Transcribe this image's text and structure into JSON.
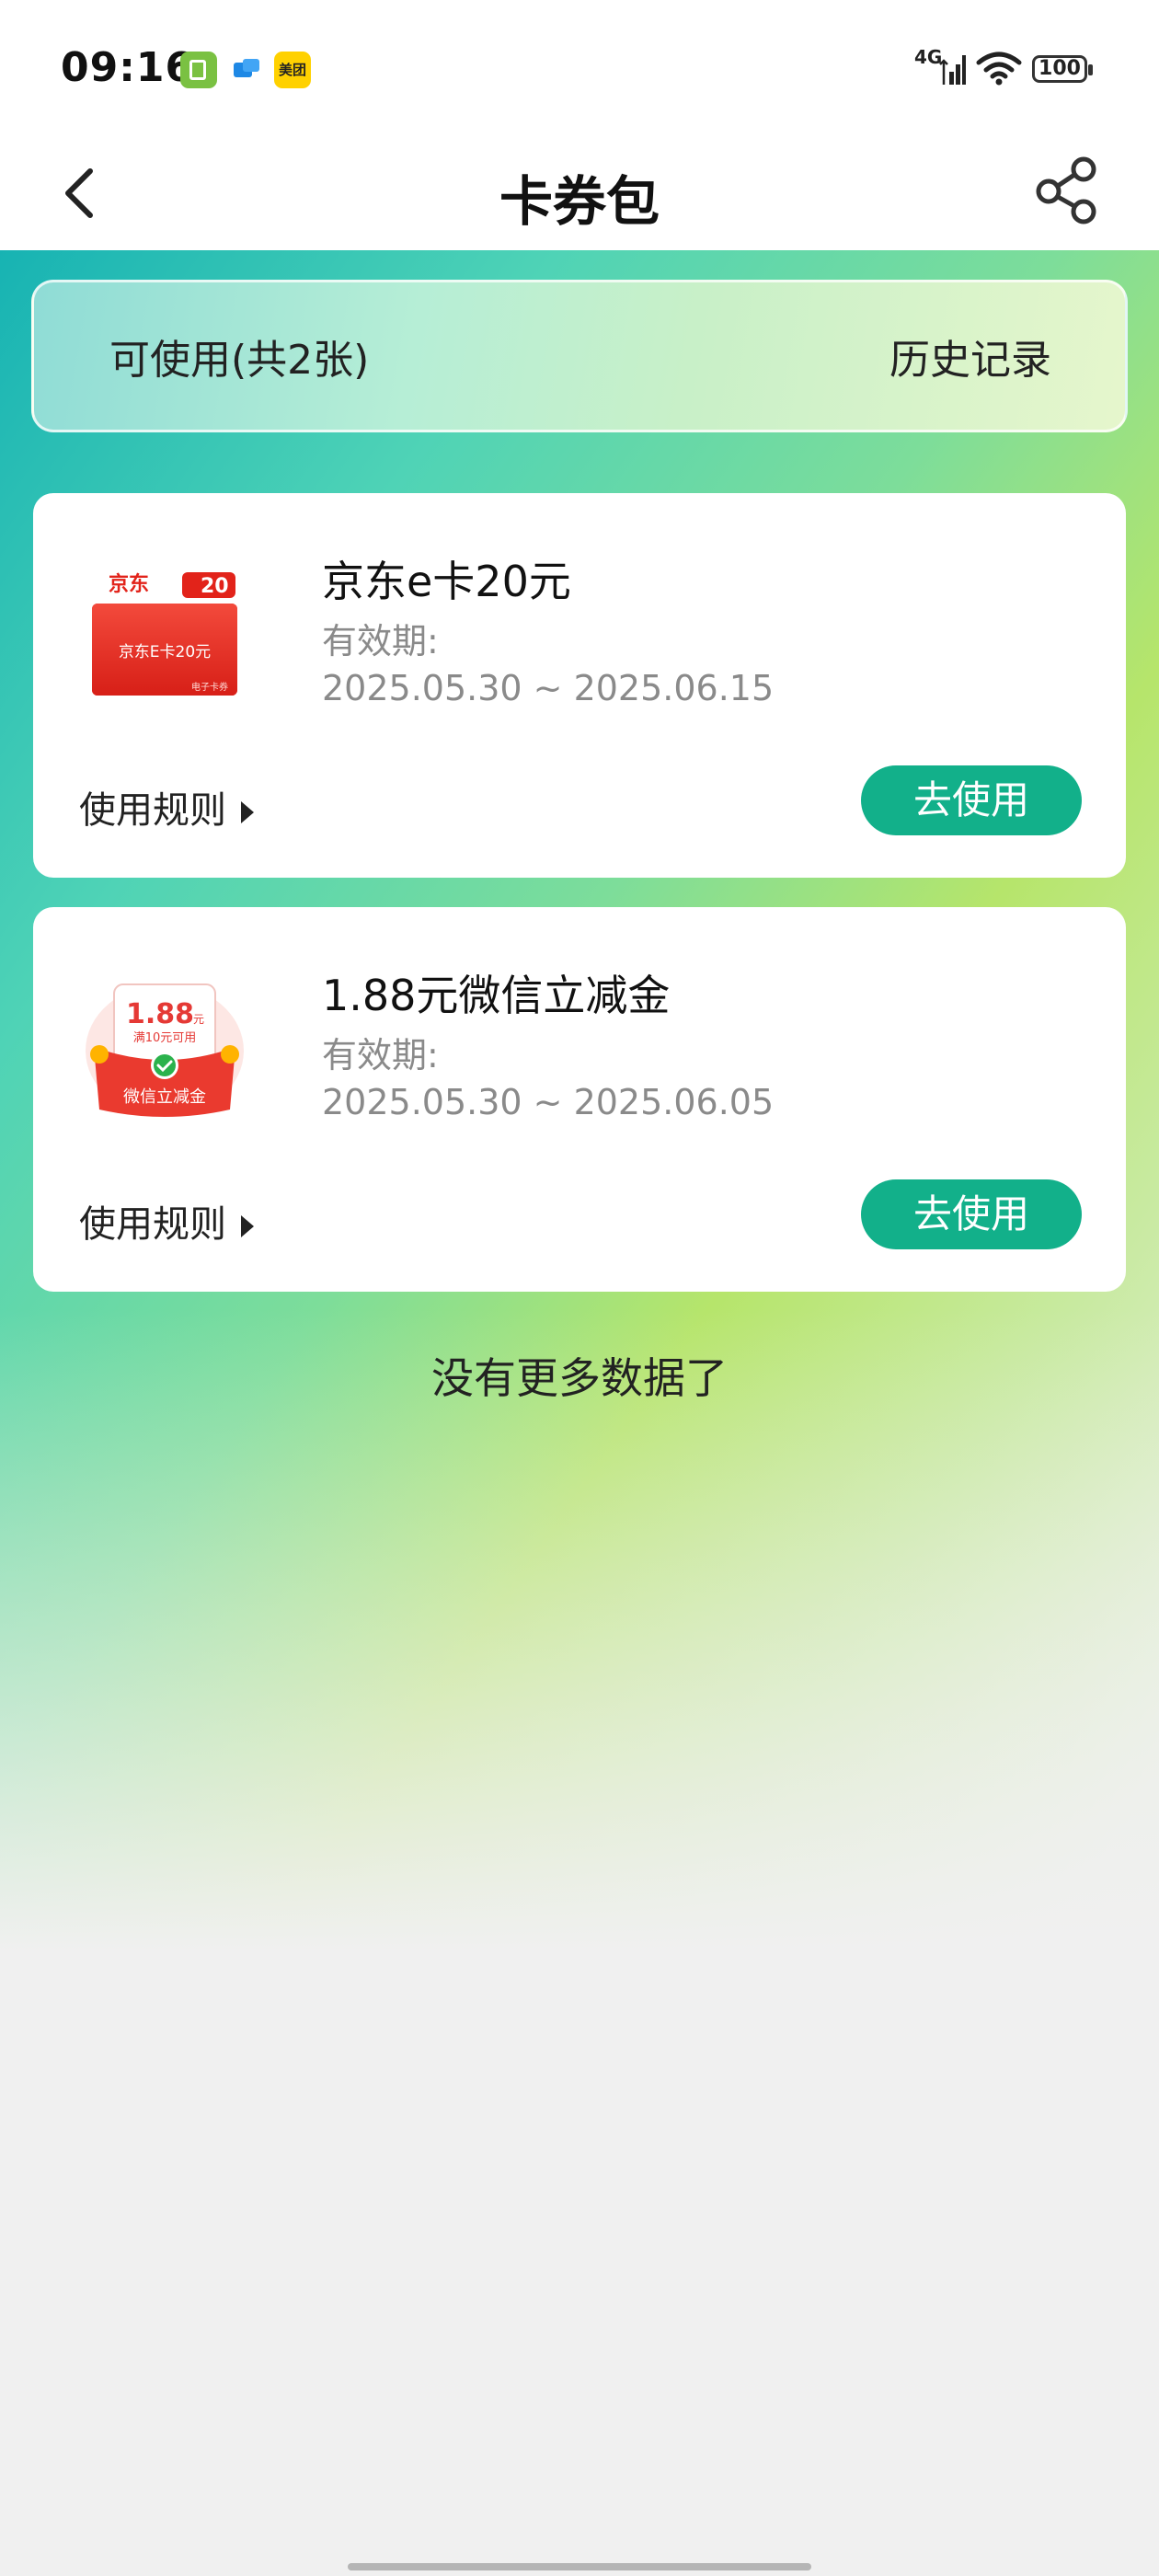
{
  "status_bar": {
    "time": "09:16",
    "meituan_label": "美团",
    "network": "4G",
    "battery": "100"
  },
  "header": {
    "title": "卡券包"
  },
  "tabs": {
    "available": "可使用(共2张)",
    "history": "历史记录"
  },
  "coupons": [
    {
      "title": "京东e卡20元",
      "validity_label": "有效期:",
      "validity_range": "2025.05.30 ~ 2025.06.15",
      "rules_label": "使用规则",
      "use_button": "去使用",
      "thumb": {
        "brand": "京东",
        "face_value": "20",
        "card_text": "京东E卡20元",
        "sub_text": "电子卡券"
      }
    },
    {
      "title": "1.88元微信立减金",
      "validity_label": "有效期:",
      "validity_range": "2025.05.30 ~ 2025.06.05",
      "rules_label": "使用规则",
      "use_button": "去使用",
      "thumb": {
        "amount": "1.88",
        "unit": "元",
        "condition": "满10元可用",
        "banner": "微信立减金"
      }
    }
  ],
  "footer": {
    "no_more": "没有更多数据了"
  },
  "colors": {
    "accent_button": "#12b08a",
    "jd_red": "#e2231a"
  }
}
